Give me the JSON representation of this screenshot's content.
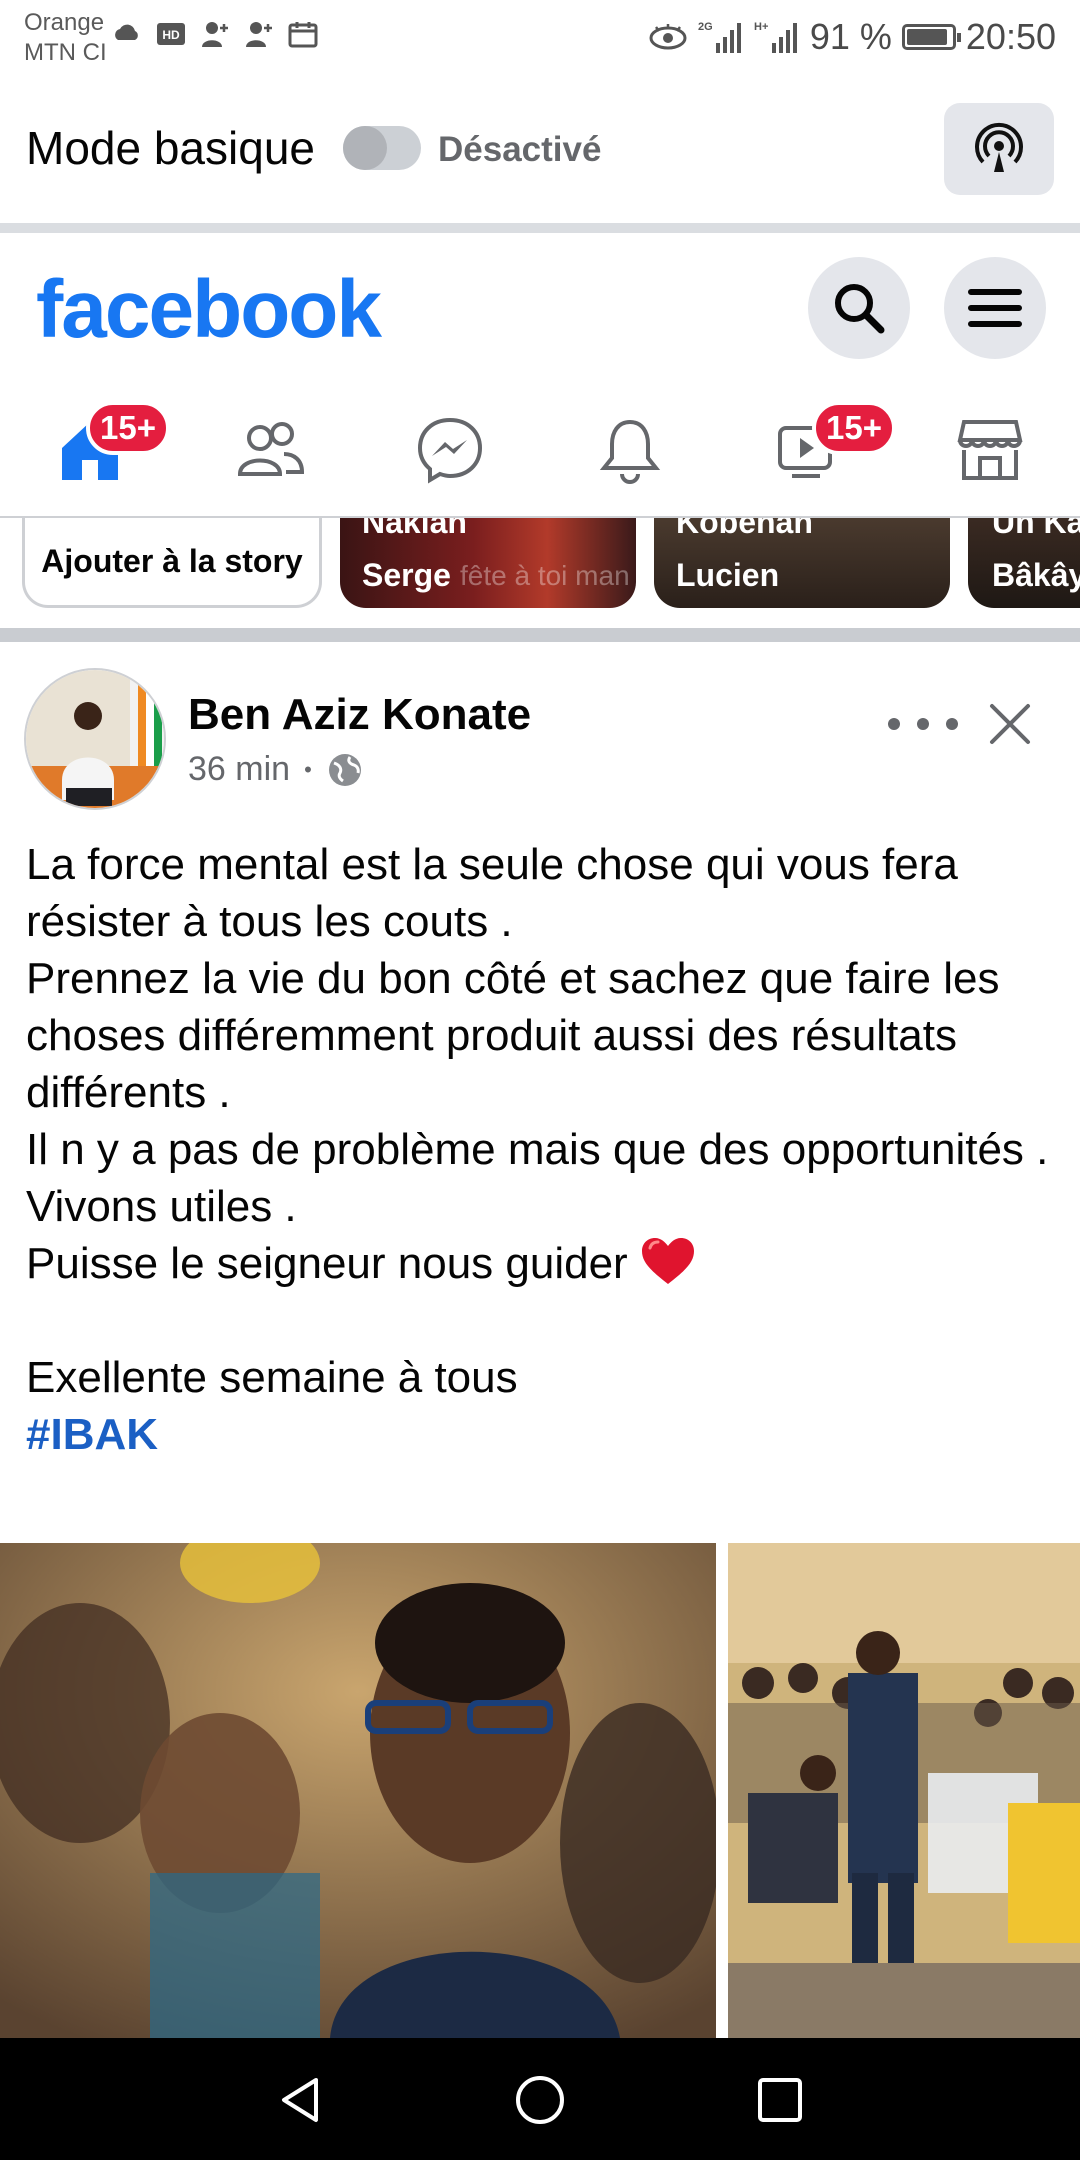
{
  "status_bar": {
    "carrier_line1": "Orange",
    "carrier_line2": "MTN CI",
    "battery_label": "91 %",
    "battery_level": 0.91,
    "time": "20:50",
    "net_label_1": "2G",
    "net_label_2": "H+"
  },
  "basic_mode": {
    "title": "Mode basique",
    "toggle_state": "Désactivé"
  },
  "header": {
    "logo": "facebook",
    "brand_color": "#1877f2"
  },
  "nav_tabs": [
    {
      "name": "home",
      "badge": "15+",
      "active": true
    },
    {
      "name": "friends",
      "badge": ""
    },
    {
      "name": "messenger",
      "badge": ""
    },
    {
      "name": "notifications",
      "badge": ""
    },
    {
      "name": "watch",
      "badge": "15+"
    },
    {
      "name": "marketplace",
      "badge": ""
    }
  ],
  "stories": {
    "add_label": "Ajouter à la story",
    "items": [
      {
        "top_text": "Naklan",
        "name": "Serge",
        "overlay": "fête à toi man"
      },
      {
        "top_text": "Kobenan",
        "name": "Lucien"
      },
      {
        "top_text": "Un Ka",
        "name": "Bâkây"
      }
    ]
  },
  "post": {
    "author": "Ben Aziz Konate",
    "time": "36 min",
    "separator": "•",
    "lines": [
      "La force mental est la seule chose qui vous fera résister à tous les couts .",
      "Prennez la vie du bon côté et sachez que faire les choses différemment produit aussi des résultats différents .",
      "Il n y a pas de problème mais que des opportunités .",
      "Vivons utiles .",
      "Puisse le seigneur nous guider",
      "",
      "Exellente semaine à tous"
    ],
    "hashtag": "#IBAK"
  }
}
